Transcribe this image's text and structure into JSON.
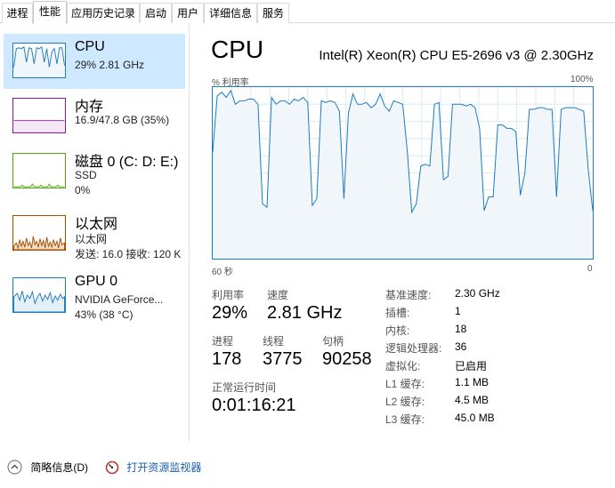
{
  "tabs": [
    "进程",
    "性能",
    "应用历史记录",
    "启动",
    "用户",
    "详细信息",
    "服务"
  ],
  "active_tab": "性能",
  "sidebar": {
    "items": [
      {
        "title": "CPU",
        "line1": "29%  2.81 GHz",
        "line2": ""
      },
      {
        "title": "内存",
        "line1": "16.9/47.8 GB (35%)",
        "line2": ""
      },
      {
        "title": "磁盘 0 (C: D: E:)",
        "line1": "SSD",
        "line2": "0%"
      },
      {
        "title": "以太网",
        "line1": "以太网",
        "line2": "发送: 16.0  接收: 120 K"
      },
      {
        "title": "GPU 0",
        "line1": "NVIDIA GeForce...",
        "line2": "43%  (38 °C)"
      }
    ]
  },
  "main": {
    "title": "CPU",
    "model": "Intel(R) Xeon(R) CPU E5-2696 v3 @ 2.30GHz",
    "graph": {
      "top_left": "% 利用率",
      "top_right": "100%",
      "bottom_left": "60 秒",
      "bottom_right": "0"
    },
    "stats": {
      "utilization_label": "利用率",
      "utilization": "29%",
      "speed_label": "速度",
      "speed": "2.81 GHz",
      "processes_label": "进程",
      "processes": "178",
      "threads_label": "线程",
      "threads": "3775",
      "handles_label": "句柄",
      "handles": "90258",
      "uptime_label": "正常运行时间",
      "uptime": "0:01:16:21"
    },
    "specs": [
      {
        "label": "基准速度:",
        "value": "2.30 GHz"
      },
      {
        "label": "插槽:",
        "value": "1"
      },
      {
        "label": "内核:",
        "value": "18"
      },
      {
        "label": "逻辑处理器:",
        "value": "36"
      },
      {
        "label": "虚拟化:",
        "value": "已启用"
      },
      {
        "label": "L1 缓存:",
        "value": "1.1 MB"
      },
      {
        "label": "L2 缓存:",
        "value": "4.5 MB"
      },
      {
        "label": "L3 缓存:",
        "value": "45.0 MB"
      }
    ]
  },
  "footer": {
    "fewer_details": "简略信息(D)",
    "open_monitor": "打开资源监视器"
  },
  "colors": {
    "cpu": "#1b7cc1",
    "memory": "#8b12ae",
    "disk": "#4da60c",
    "ethernet": "#a74f01",
    "gpu": "#1b7cc1",
    "selected_bg": "#cde8ff",
    "link": "#1a5fb4"
  },
  "cpu_usage_history": [
    0.62,
    0.95,
    0.97,
    0.94,
    0.98,
    0.9,
    0.92,
    0.92,
    0.93,
    0.93,
    0.9,
    0.32,
    0.3,
    0.94,
    0.9,
    0.92,
    0.92,
    0.9,
    0.93,
    0.92,
    0.94,
    0.91,
    0.31,
    0.35,
    0.92,
    0.91,
    0.92,
    0.91,
    0.86,
    0.35,
    0.85,
    0.96,
    0.9,
    0.9,
    0.91,
    0.88,
    0.9,
    0.96,
    0.89,
    0.86,
    0.92,
    0.91,
    0.9,
    0.63,
    0.27,
    0.32,
    0.54,
    0.55,
    0.54,
    0.9,
    0.91,
    0.46,
    0.48,
    0.9,
    0.9,
    0.9,
    0.89,
    0.9,
    0.88,
    0.76,
    0.28,
    0.36,
    0.36,
    0.78,
    0.78,
    0.76,
    0.76,
    0.74,
    0.37,
    0.5,
    0.87,
    0.87,
    0.88,
    0.88,
    0.87,
    0.87,
    0.36,
    0.87,
    0.88,
    0.88,
    0.88,
    0.87,
    0.86,
    0.52,
    0.28
  ]
}
